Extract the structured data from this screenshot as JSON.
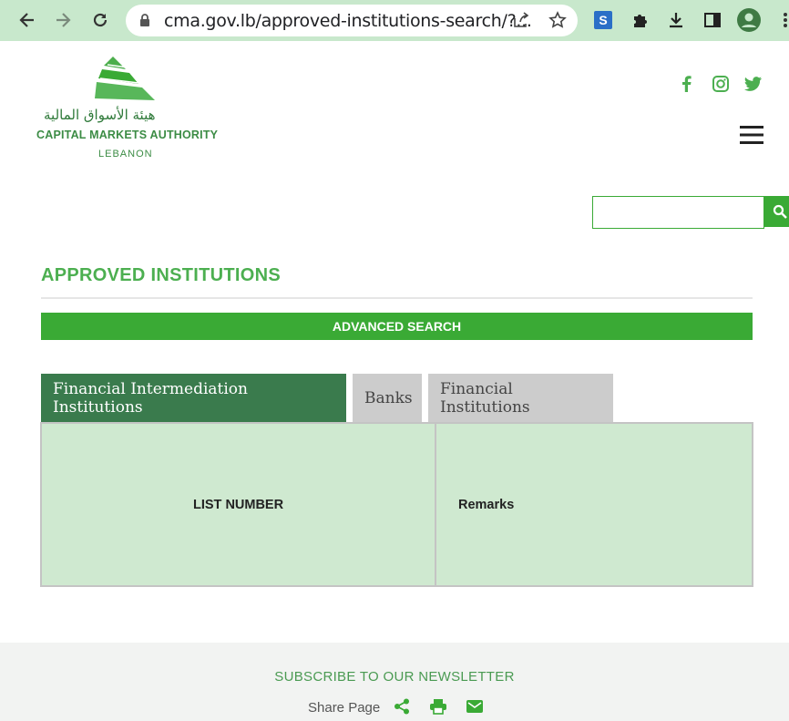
{
  "browser": {
    "url": "cma.gov.lb/approved-institutions-search/?...",
    "back_icon": "back-arrow-icon",
    "forward_icon": "forward-arrow-icon",
    "reload_icon": "reload-icon",
    "lock_icon": "lock-icon",
    "share_icon": "share-icon",
    "bookmark_icon": "star-icon",
    "extension_icon": "puzzle-icon",
    "download_icon": "download-icon",
    "sidepanel_icon": "side-panel-icon",
    "profile_icon": "avatar-icon",
    "menu_icon": "kebab-menu-icon",
    "chrome_color": "#c8e8cc"
  },
  "header": {
    "logo_arabic": "هيئة الأسواق المالية",
    "logo_english": "CAPITAL MARKETS AUTHORITY",
    "logo_country": "LEBANON",
    "social": [
      "facebook-icon",
      "instagram-icon",
      "twitter-icon"
    ],
    "menu_icon": "hamburger-menu-icon",
    "search_placeholder": "",
    "search_icon": "search-icon"
  },
  "main": {
    "title": "APPROVED INSTITUTIONS",
    "advanced_search_label": "ADVANCED SEARCH",
    "tabs": [
      {
        "label": "Financial Intermediation Institutions",
        "active": true
      },
      {
        "label": "Banks",
        "active": false
      },
      {
        "label": "Financial Institutions",
        "active": false
      }
    ],
    "table": {
      "columns": [
        "LIST NUMBER",
        "Remarks"
      ]
    }
  },
  "footer": {
    "newsletter_label": "SUBSCRIBE TO OUR NEWSLETTER",
    "share_label": "Share Page",
    "share_icons": [
      "share-nodes-icon",
      "print-icon",
      "email-icon"
    ]
  },
  "colors": {
    "brand_green": "#3aaa35",
    "tab_active": "#3a7b4d",
    "table_bg": "#cfe9d0"
  }
}
